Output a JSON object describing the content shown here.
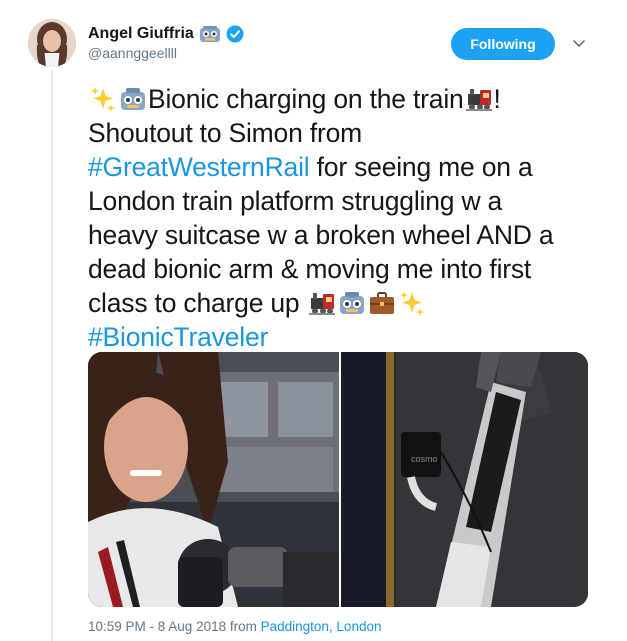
{
  "header": {
    "display_name": "Angel Giuffria",
    "handle": "@aannggeellll",
    "follow_label": "Following"
  },
  "icons": {
    "verified": "verified-badge-icon",
    "chevron": "chevron-down-icon",
    "avatar": "profile-avatar"
  },
  "colors": {
    "accent": "#1da1f2",
    "link": "#1b95e0",
    "muted": "#657786",
    "text": "#14171a"
  },
  "tweet": {
    "line1_text": " Bionic charging on the train",
    "line1_end": "!",
    "line2": "Shoutout to Simon from",
    "hashtag1": "#GreatWesternRail",
    "line3_rest": " for seeing me on a",
    "line4": "London train platform struggling w a",
    "line5": "heavy suitcase w a broken wheel AND a",
    "line6": "dead bionic arm & moving me into first",
    "line7": "class to charge up ",
    "hashtag2": "#BionicTraveler"
  },
  "media": {
    "photo1_caption": "Selfie on train",
    "photo2_caption": "Bionic arm charging",
    "charger_label": "cosmo"
  },
  "footer": {
    "time_date": "10:59 PM - 8 Aug 2018 from ",
    "location": "Paddington, London"
  }
}
